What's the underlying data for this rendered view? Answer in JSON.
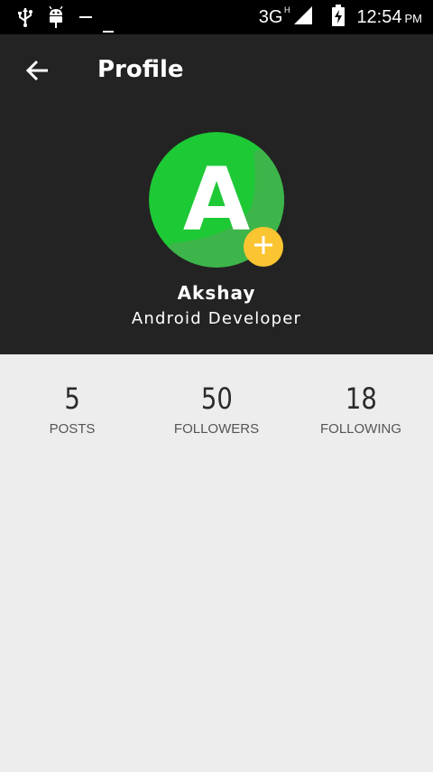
{
  "status_bar": {
    "network_type": "3G",
    "network_sub": "H",
    "time": "12:54",
    "ampm": "PM",
    "icons": [
      "usb-icon",
      "android-debug-icon",
      "signal-icon",
      "battery-charging-icon"
    ]
  },
  "toolbar": {
    "title": "Profile",
    "back_icon": "arrow-left-icon"
  },
  "profile": {
    "initial": "A",
    "name": "Akshay",
    "role": "Android Developer",
    "avatar_colors": {
      "primary": "#1ec936",
      "shade": "#3db54a"
    },
    "badge_color": "#fbc531"
  },
  "stats": [
    {
      "value": "5",
      "label": "POSTS"
    },
    {
      "value": "50",
      "label": "FOLLOWERS"
    },
    {
      "value": "18",
      "label": "FOLLOWING"
    }
  ],
  "colors": {
    "header_bg": "#232323",
    "content_bg": "#ededed",
    "status_bg": "#000000"
  }
}
